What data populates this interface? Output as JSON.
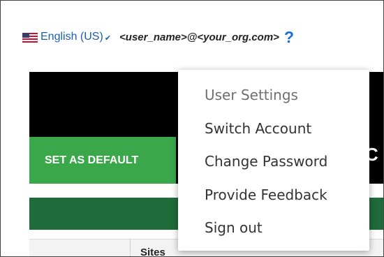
{
  "header": {
    "language_label": "English (US)",
    "language_caret_icon": "chevron-down-icon",
    "user_label": "<user_name>@<your_org.com>",
    "help_icon": "help-icon",
    "help_glyph": "?",
    "accent_color": "#1a5fb4"
  },
  "page": {
    "set_default_label": "SET AS DEFAULT",
    "cutoff_glyph": "C",
    "table_column_sites": "Sites",
    "button_color": "#3aa84a"
  },
  "user_menu": {
    "items": [
      {
        "label": "User Settings"
      },
      {
        "label": "Switch Account"
      },
      {
        "label": "Change Password"
      },
      {
        "label": "Provide Feedback"
      },
      {
        "label": "Sign out"
      }
    ]
  }
}
